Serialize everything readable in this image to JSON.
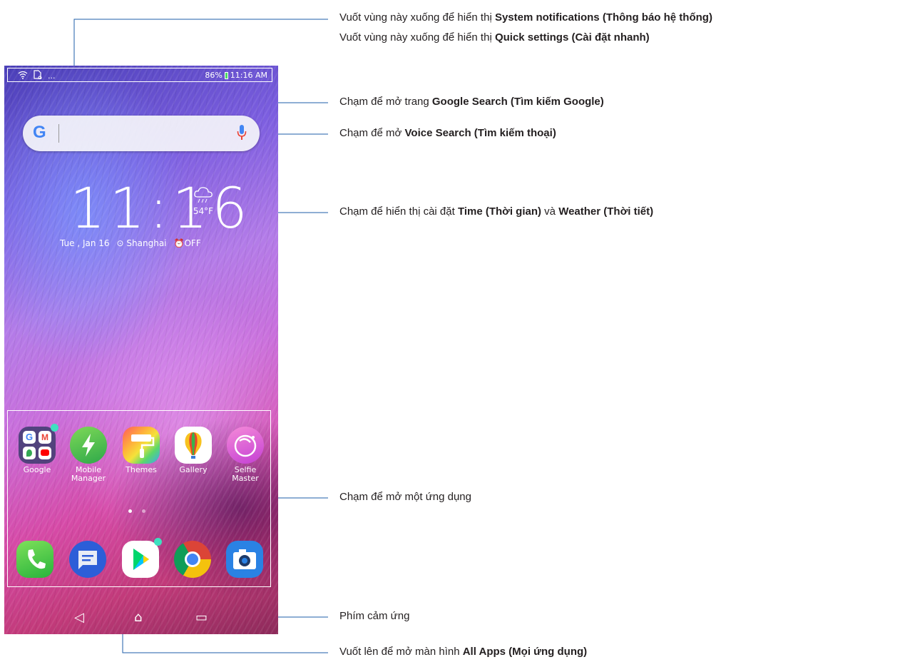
{
  "status_bar": {
    "battery": "86%",
    "time": "11:16 AM",
    "more": "..."
  },
  "search_bar": {
    "logo": "G"
  },
  "clock": {
    "time": "11:16",
    "temperature": "54°F",
    "date": "Tue , Jan 16",
    "location": "Shanghai",
    "alarm": "OFF"
  },
  "apps": [
    {
      "label": "Google"
    },
    {
      "label": "Mobile Manager"
    },
    {
      "label": "Themes"
    },
    {
      "label": "Gallery"
    },
    {
      "label": "Selfie Master"
    }
  ],
  "dock": [
    "Phone",
    "Messages",
    "Play Store",
    "Chrome",
    "Camera"
  ],
  "nav": {
    "back": "◁",
    "home": "⌂",
    "recent": "▭"
  },
  "annotations": {
    "notif_pre": "Vuốt vùng này xuống để hiển thị ",
    "notif_bold": "System notifications (Thông báo hệ thống)",
    "quick_pre": "Vuốt vùng này xuống để hiển thị ",
    "quick_bold": "Quick settings (Cài đặt nhanh)",
    "gsearch_pre": "Chạm để mở trang ",
    "gsearch_bold": "Google Search (Tìm kiếm Google)",
    "voice_pre": "Chạm để mở ",
    "voice_bold": "Voice Search (Tìm kiếm thoại)",
    "time_pre": "Chạm để hiển thị cài đặt ",
    "time_bold": "Time (Thời gian)",
    "time_mid": " và ",
    "weather_bold": "Weather (Thời tiết)",
    "app_text": "Chạm để mở một ứng dụng",
    "keys_text": "Phím cảm ứng",
    "allapps_pre": "Vuốt lên để mở màn hình ",
    "allapps_bold": "All Apps (Mọi ứng dụng)"
  },
  "colors": {
    "line": "#1e5ea8",
    "phone_green": "#4cd964",
    "badge": "#3ee0c0"
  }
}
